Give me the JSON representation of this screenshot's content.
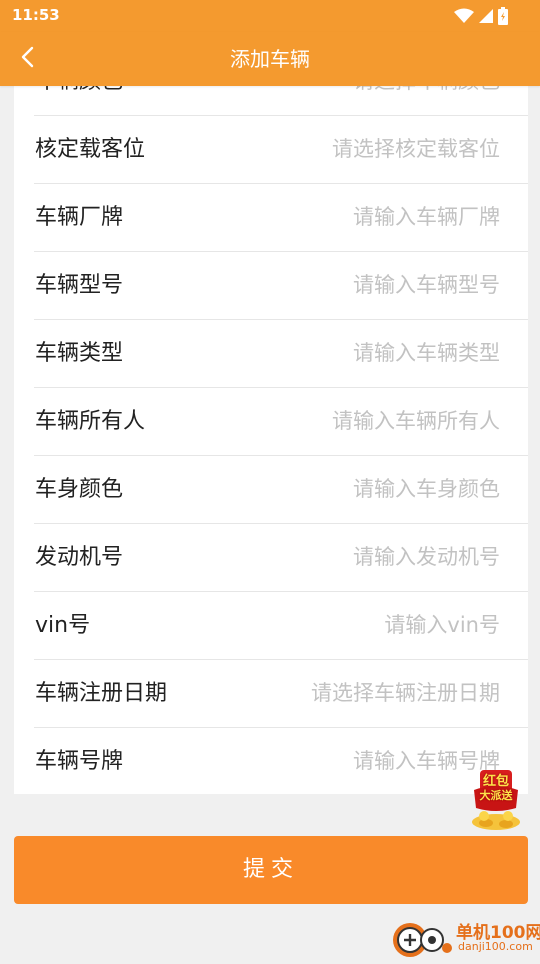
{
  "status_bar": {
    "time": "11:53",
    "icons": [
      "wifi-icon",
      "cell-signal-icon",
      "battery-icon"
    ]
  },
  "app_bar": {
    "title": "添加车辆",
    "back_icon": "chevron-left-icon",
    "background": "#f49a2f"
  },
  "form": {
    "rows": [
      {
        "label": "车辆颜色",
        "placeholder": "请选择车辆颜色"
      },
      {
        "label": "核定载客位",
        "placeholder": "请选择核定载客位"
      },
      {
        "label": "车辆厂牌",
        "placeholder": "请输入车辆厂牌"
      },
      {
        "label": "车辆型号",
        "placeholder": "请输入车辆型号"
      },
      {
        "label": "车辆类型",
        "placeholder": "请输入车辆类型"
      },
      {
        "label": "车辆所有人",
        "placeholder": "请输入车辆所有人"
      },
      {
        "label": "车身颜色",
        "placeholder": "请输入车身颜色"
      },
      {
        "label": "发动机号",
        "placeholder": "请输入发动机号"
      },
      {
        "label": "vin号",
        "placeholder": "请输入vin号"
      },
      {
        "label": "车辆注册日期",
        "placeholder": "请选择车辆注册日期"
      },
      {
        "label": "车辆号牌",
        "placeholder": "请输入车辆号牌"
      }
    ]
  },
  "submit": {
    "label": "提交",
    "color": "#f98a2a"
  },
  "red_packet": {
    "line1": "红包",
    "line2": "大派送"
  },
  "watermark": {
    "name": "单机100网",
    "url": "danji100.com"
  }
}
